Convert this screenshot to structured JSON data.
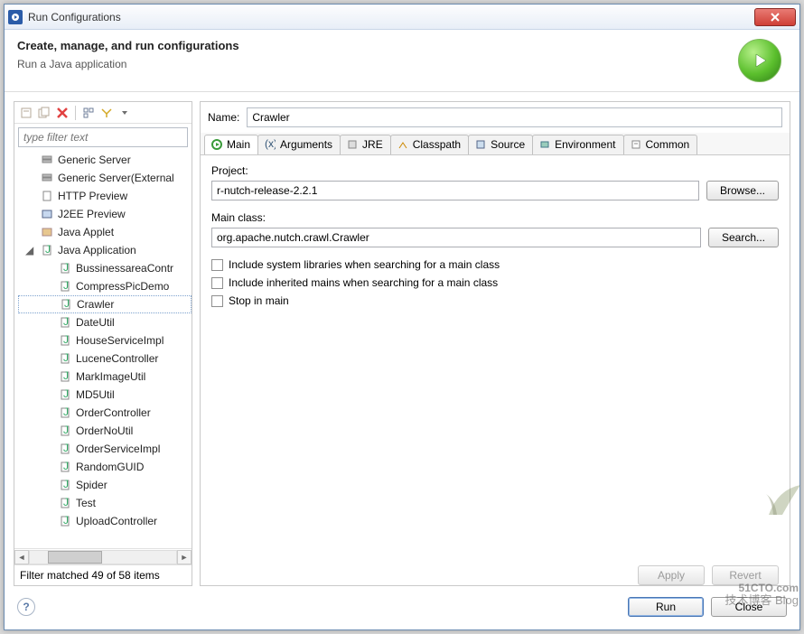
{
  "titlebar": {
    "title": "Run Configurations"
  },
  "header": {
    "heading": "Create, manage, and run configurations",
    "sub": "Run a Java application"
  },
  "left": {
    "filter_placeholder": "type filter text",
    "items": [
      {
        "label": "Generic Server",
        "level": 1,
        "kind": "server"
      },
      {
        "label": "Generic Server(External",
        "level": 1,
        "kind": "server"
      },
      {
        "label": "HTTP Preview",
        "level": 1,
        "kind": "doc"
      },
      {
        "label": "J2EE Preview",
        "level": 1,
        "kind": "j2ee"
      },
      {
        "label": "Java Applet",
        "level": 1,
        "kind": "applet"
      },
      {
        "label": "Java Application",
        "level": 1,
        "kind": "java",
        "expanded": true
      },
      {
        "label": "BussinessareaContr",
        "level": 2,
        "kind": "java"
      },
      {
        "label": "CompressPicDemo",
        "level": 2,
        "kind": "java"
      },
      {
        "label": "Crawler",
        "level": 2,
        "kind": "java",
        "selected": true
      },
      {
        "label": "DateUtil",
        "level": 2,
        "kind": "java"
      },
      {
        "label": "HouseServiceImpl",
        "level": 2,
        "kind": "java"
      },
      {
        "label": "LuceneController",
        "level": 2,
        "kind": "java"
      },
      {
        "label": "MarkImageUtil",
        "level": 2,
        "kind": "java"
      },
      {
        "label": "MD5Util",
        "level": 2,
        "kind": "java"
      },
      {
        "label": "OrderController",
        "level": 2,
        "kind": "java"
      },
      {
        "label": "OrderNoUtil",
        "level": 2,
        "kind": "java"
      },
      {
        "label": "OrderServiceImpl",
        "level": 2,
        "kind": "java"
      },
      {
        "label": "RandomGUID",
        "level": 2,
        "kind": "java"
      },
      {
        "label": "Spider",
        "level": 2,
        "kind": "java"
      },
      {
        "label": "Test",
        "level": 2,
        "kind": "java"
      },
      {
        "label": "UploadController",
        "level": 2,
        "kind": "java"
      }
    ],
    "status": "Filter matched 49 of 58 items"
  },
  "right": {
    "name_label": "Name:",
    "name_value": "Crawler",
    "tabs": [
      "Main",
      "Arguments",
      "JRE",
      "Classpath",
      "Source",
      "Environment",
      "Common"
    ],
    "active_tab": 0,
    "project_label": "Project:",
    "project_value": "r-nutch-release-2.2.1",
    "browse_label": "Browse...",
    "mainclass_label": "Main class:",
    "mainclass_value": "org.apache.nutch.crawl.Crawler",
    "search_label": "Search...",
    "check1": "Include system libraries when searching for a main class",
    "check2": "Include inherited mains when searching for a main class",
    "check3": "Stop in main",
    "apply_label": "Apply",
    "revert_label": "Revert"
  },
  "footer": {
    "run_label": "Run",
    "close_label": "Close"
  },
  "watermark": {
    "main": "51CTO.com",
    "sub": "技术博客 Blog"
  }
}
